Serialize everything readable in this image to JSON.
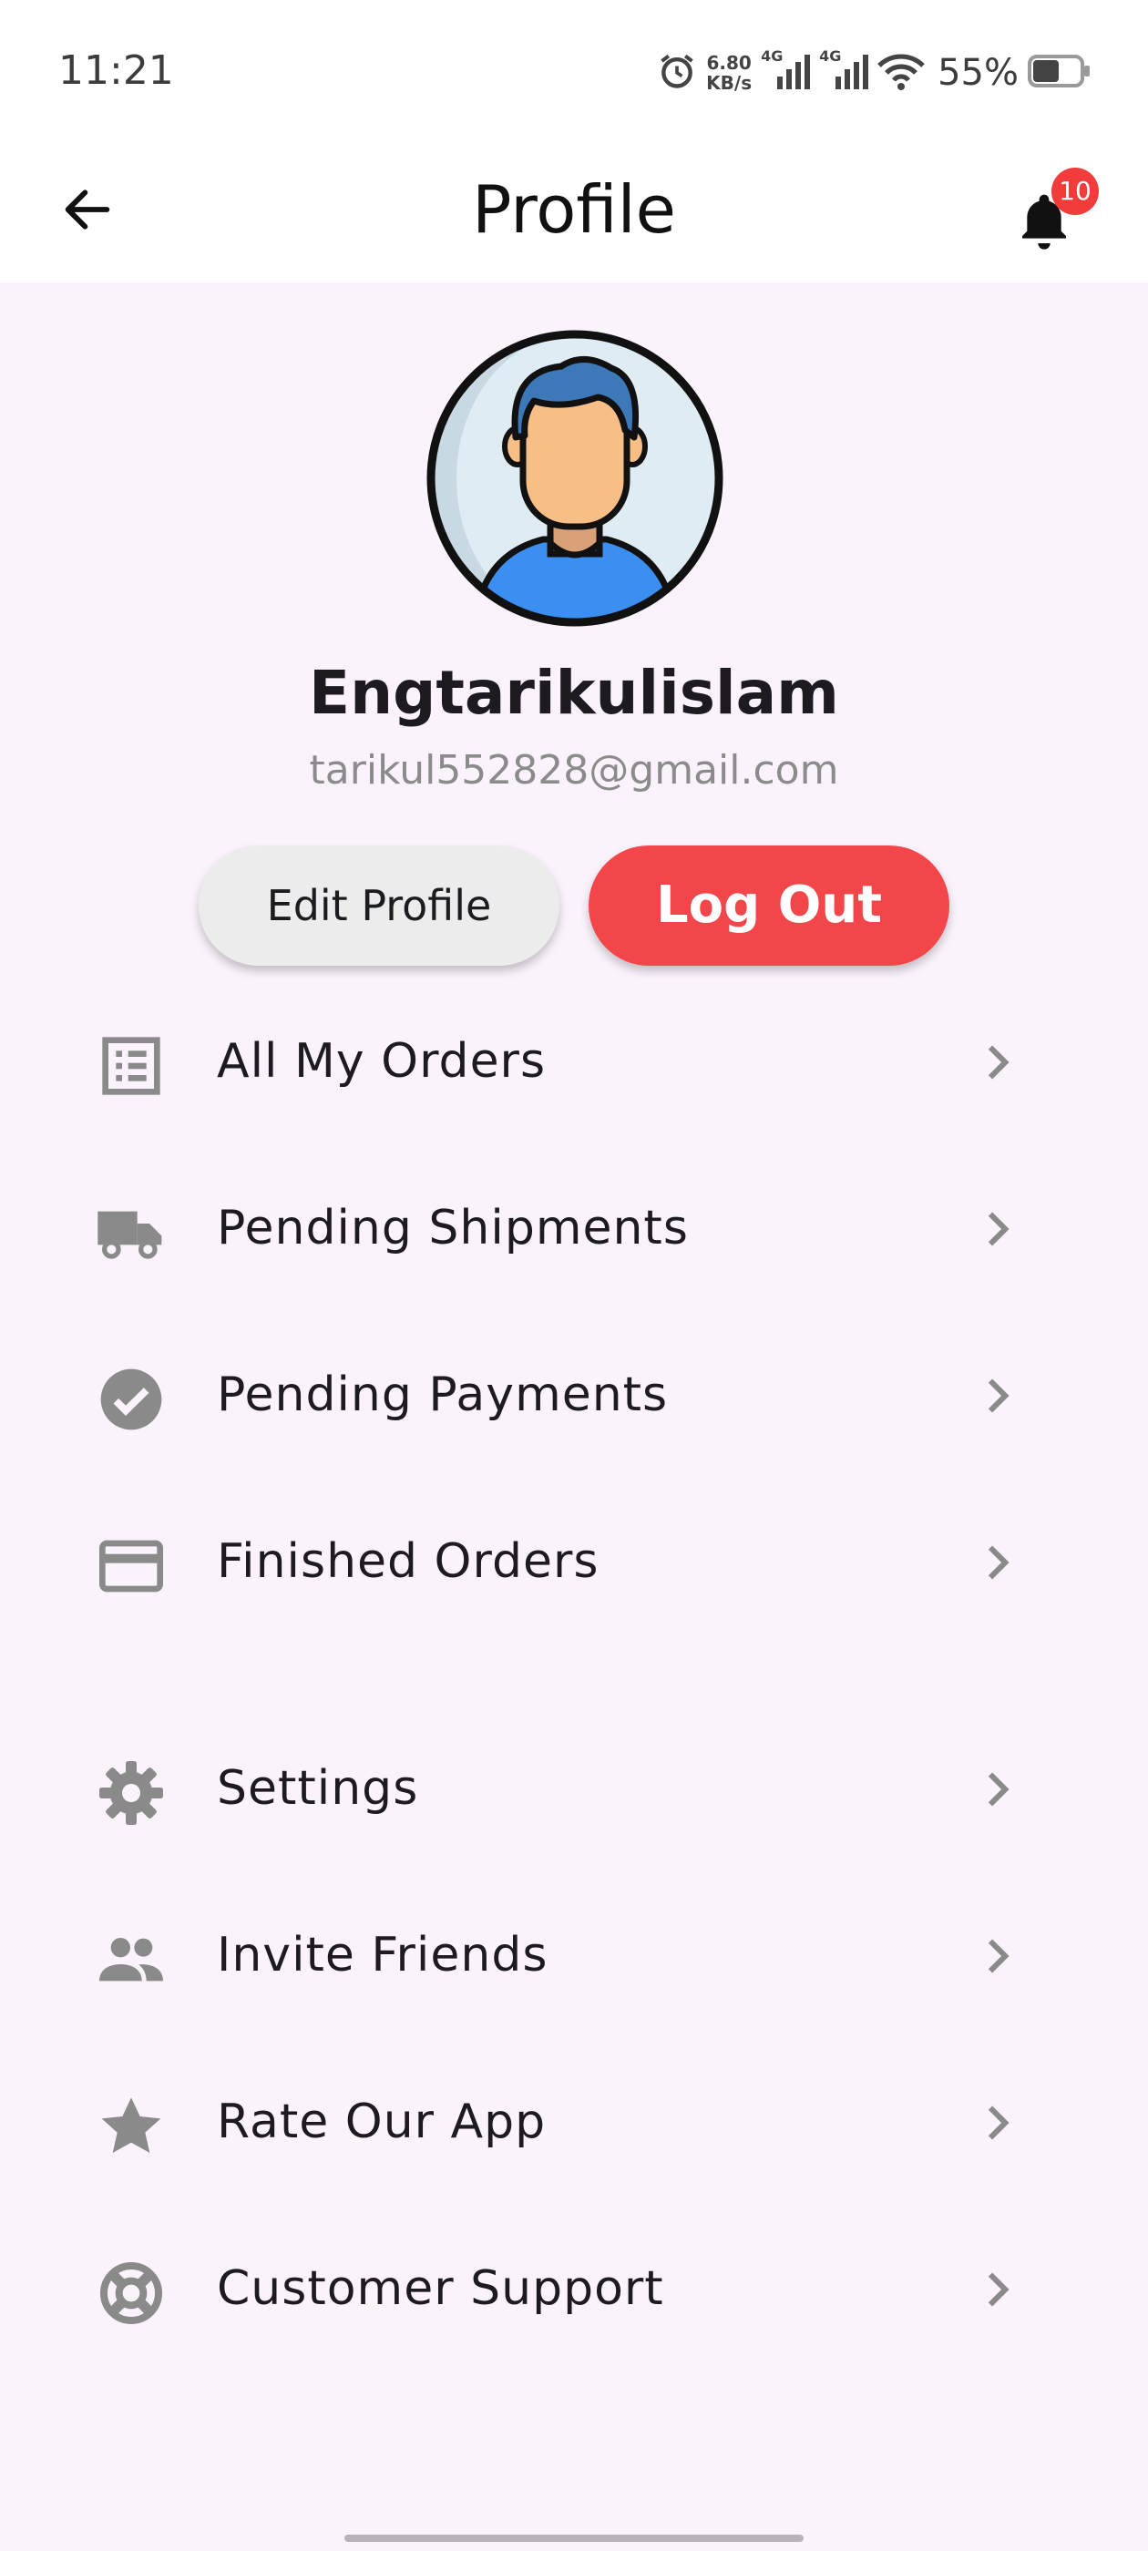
{
  "status_bar": {
    "time": "11:21",
    "speed_value": "6.80",
    "speed_unit": "KB/s",
    "network_1": "4G",
    "network_2": "4G",
    "battery": "55%"
  },
  "header": {
    "title": "Profile",
    "notification_count": "10"
  },
  "profile": {
    "name": "Engtarikulislam",
    "email": "tarikul552828@gmail.com",
    "edit_label": "Edit Profile",
    "logout_label": "Log Out"
  },
  "menu": {
    "orders": [
      {
        "label": "All My Orders",
        "icon": "list-icon"
      },
      {
        "label": "Pending Shipments",
        "icon": "truck-icon"
      },
      {
        "label": "Pending Payments",
        "icon": "check-circle-icon"
      },
      {
        "label": "Finished Orders",
        "icon": "card-icon"
      }
    ],
    "general": [
      {
        "label": "Settings",
        "icon": "gear-icon"
      },
      {
        "label": "Invite Friends",
        "icon": "people-icon"
      },
      {
        "label": "Rate Our App",
        "icon": "star-icon"
      },
      {
        "label": "Customer Support",
        "icon": "lifebuoy-icon"
      }
    ]
  },
  "colors": {
    "background": "#fbf3fb",
    "logout": "#f2464a",
    "badge": "#f23b3b",
    "icon": "#8a8a8a"
  }
}
